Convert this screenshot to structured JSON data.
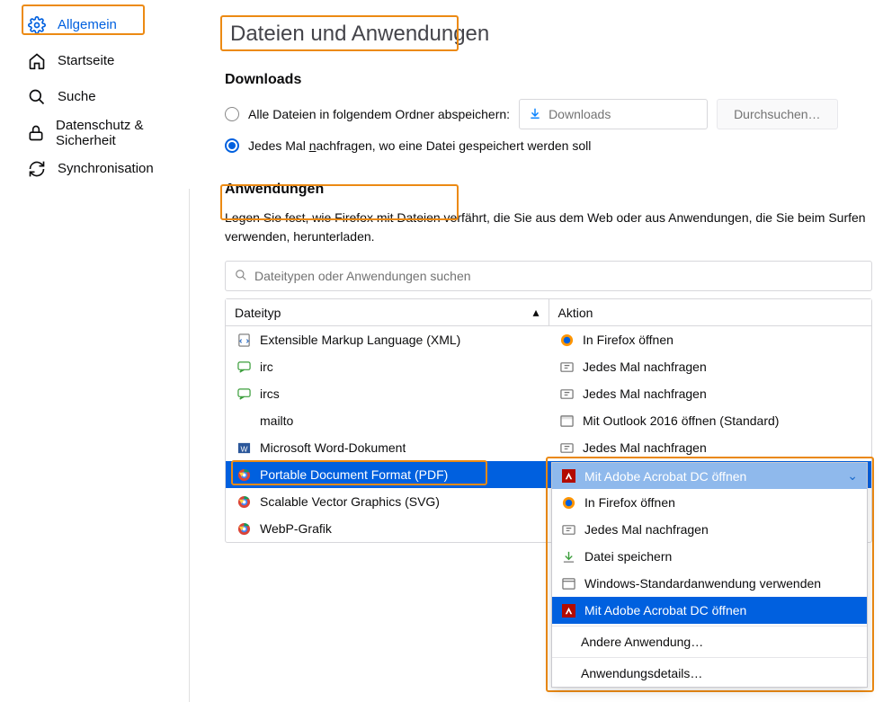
{
  "sidebar": {
    "items": [
      {
        "label": "Allgemein",
        "icon": "gear-icon",
        "active": true
      },
      {
        "label": "Startseite",
        "icon": "home-icon",
        "active": false
      },
      {
        "label": "Suche",
        "icon": "search-icon",
        "active": false
      },
      {
        "label": "Datenschutz & Sicherheit",
        "icon": "lock-icon",
        "active": false
      },
      {
        "label": "Synchronisation",
        "icon": "sync-icon",
        "active": false
      }
    ]
  },
  "main": {
    "section_title": "Dateien und Anwendungen",
    "downloads": {
      "heading": "Downloads",
      "option_folder_label": "Alle Dateien in folgendem Ordner abspeichern:",
      "folder_placeholder": "Downloads",
      "browse_label": "Durchsuchen…",
      "option_ask_prefix": "Jedes Mal ",
      "option_ask_key": "n",
      "option_ask_suffix": "achfragen, wo eine Datei gespeichert werden soll"
    },
    "applications": {
      "heading": "Anwendungen",
      "description": "Legen Sie fest, wie Firefox mit Dateien verfährt, die Sie aus dem Web oder aus Anwendungen, die Sie beim Surfen verwenden, herunterladen.",
      "search_placeholder": "Dateitypen oder Anwendungen suchen",
      "columns": {
        "type": "Dateityp",
        "action": "Aktion"
      },
      "rows": [
        {
          "type_icon": "xml-icon",
          "type": "Extensible Markup Language (XML)",
          "action_icon": "firefox-icon",
          "action": "In Firefox öffnen"
        },
        {
          "type_icon": "irc-icon",
          "type": "irc",
          "action_icon": "ask-icon",
          "action": "Jedes Mal nachfragen"
        },
        {
          "type_icon": "irc-icon",
          "type": "ircs",
          "action_icon": "ask-icon",
          "action": "Jedes Mal nachfragen"
        },
        {
          "type_icon": "",
          "type": "mailto",
          "action_icon": "outlook-icon",
          "action": "Mit Outlook 2016 öffnen (Standard)"
        },
        {
          "type_icon": "word-icon",
          "type": "Microsoft Word-Dokument",
          "action_icon": "ask-icon",
          "action": "Jedes Mal nachfragen"
        },
        {
          "type_icon": "chrome-icon",
          "type": "Portable Document Format (PDF)",
          "action_icon": "adobe-icon",
          "action": "Mit Adobe Acrobat DC  öffnen",
          "selected": true
        },
        {
          "type_icon": "chrome-icon",
          "type": "Scalable Vector Graphics (SVG)",
          "action_icon": "",
          "action": ""
        },
        {
          "type_icon": "chrome-icon",
          "type": "WebP-Grafik",
          "action_icon": "",
          "action": ""
        }
      ],
      "dropdown": {
        "selected": "Mit Adobe Acrobat DC  öffnen",
        "items": [
          {
            "icon": "firefox-icon",
            "label": "In Firefox öffnen"
          },
          {
            "icon": "ask-icon",
            "label": "Jedes Mal nachfragen"
          },
          {
            "icon": "save-icon",
            "label": "Datei speichern"
          },
          {
            "icon": "window-icon",
            "label": "Windows-Standardanwendung verwenden"
          },
          {
            "icon": "adobe-icon",
            "label": "Mit Adobe Acrobat DC  öffnen",
            "active": true
          },
          {
            "icon": "",
            "label": "Andere Anwendung…",
            "indent": true,
            "sep_before": true
          },
          {
            "icon": "",
            "label": "Anwendungsdetails…",
            "indent": true,
            "sep_before": true
          }
        ]
      }
    }
  }
}
